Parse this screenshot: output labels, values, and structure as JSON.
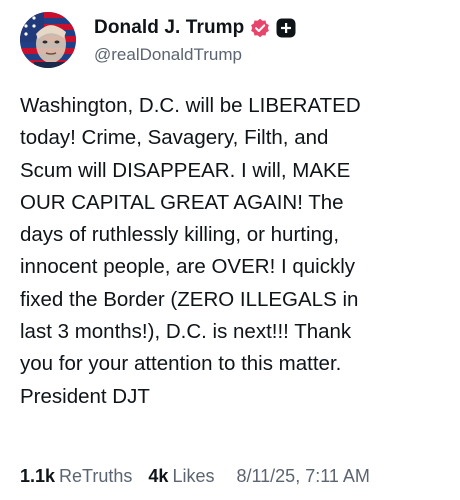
{
  "author": {
    "display_name": "Donald J. Trump",
    "handle": "@realDonaldTrump",
    "avatar_icon": "profile-photo",
    "verified_icon": "verified-badge-icon",
    "plus_icon": "plus-icon",
    "accent_color": "#e8456b"
  },
  "post": {
    "text": "Washington, D.C. will be LIBERATED\ntoday! Crime, Savagery, Filth, and\nScum will DISAPPEAR. I will, MAKE\nOUR CAPITAL GREAT AGAIN! The\ndays of ruthlessly killing, or hurting,\ninnocent people, are OVER! I quickly\nfixed the Border (ZERO ILLEGALS in\nlast 3 months!), D.C. is next!!! Thank\nyou for your attention to this matter.\nPresident DJT"
  },
  "stats": {
    "retruths_count": "1.1k",
    "retruths_label": "ReTruths",
    "likes_count": "4k",
    "likes_label": "Likes",
    "timestamp": "8/11/25, 7:11 AM"
  }
}
